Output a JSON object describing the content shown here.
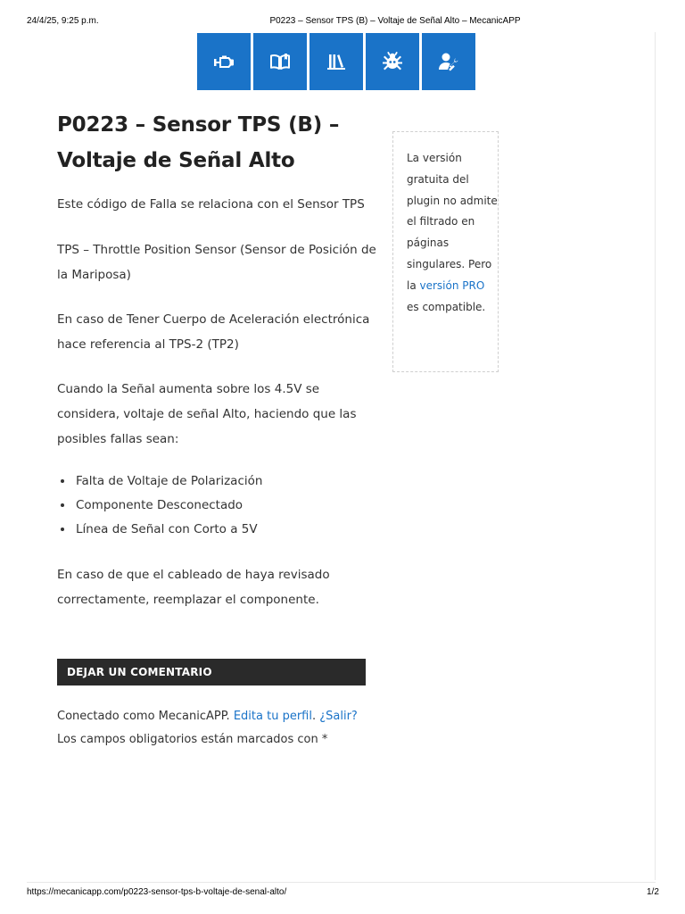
{
  "print_header": {
    "date": "24/4/25, 9:25 p.m.",
    "title": "P0223 – Sensor TPS (B) – Voltaje de Señal Alto – MecanicAPP"
  },
  "nav": {
    "items": [
      {
        "icon": "engine-icon"
      },
      {
        "icon": "open-book-icon"
      },
      {
        "icon": "library-books-icon"
      },
      {
        "icon": "bug-icon"
      },
      {
        "icon": "user-wrench-icon"
      }
    ],
    "color": "#1a73c8"
  },
  "article": {
    "title": "P0223 – Sensor TPS (B) – Voltaje de Señal Alto",
    "para1": "Este código de Falla se relaciona con el Sensor TPS",
    "para2": "TPS – Throttle Position Sensor (Sensor de Posición de la Mariposa)",
    "para3": "En caso de Tener Cuerpo de Aceleración electrónica hace referencia al TPS-2 (TP2)",
    "para4": "Cuando la Señal aumenta sobre los 4.5V se considera, voltaje de señal Alto, haciendo que las posibles fallas sean:",
    "list": [
      "Falta de Voltaje de Polarización",
      "Componente Desconectado",
      "Línea de Señal con Corto a 5V"
    ],
    "para5": "En caso de que el cableado de haya revisado correctamente, reemplazar el componente."
  },
  "comments": {
    "heading": "DEJAR UN COMENTARIO",
    "logged_prefix": "Conectado como MecanicAPP.",
    "edit_profile": "Edita tu perfil",
    "logout": "¿Salir?",
    "required_note": "Los campos obligatorios están marcados con *"
  },
  "widget": {
    "text_before": "La versión gratuita del plugin no admite el filtrado en páginas singulares. Pero la",
    "link": "versión PRO",
    "text_after": "es compatible."
  },
  "print_footer": {
    "url": "https://mecanicapp.com/p0223-sensor-tps-b-voltaje-de-senal-alto/",
    "pages": "1/2"
  }
}
